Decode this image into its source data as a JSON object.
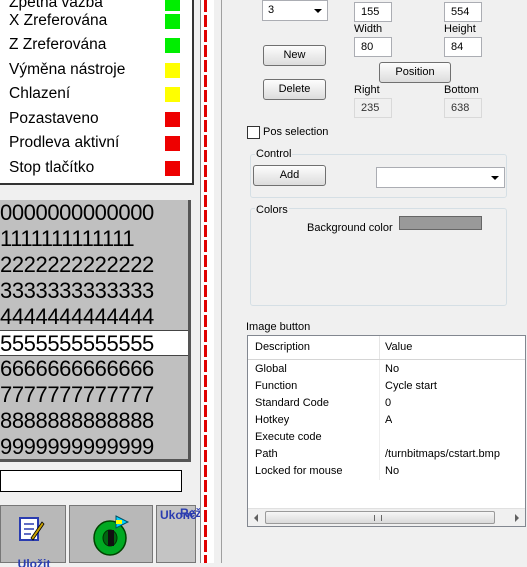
{
  "status_list": [
    {
      "label": "Zpětná vazba",
      "color": "#00ee00"
    },
    {
      "label": "X Zreferována",
      "color": "#00ee00"
    },
    {
      "label": "Z Zreferována",
      "color": "#00ee00"
    },
    {
      "label": "Výměna nástroje",
      "color": "#ffff00"
    },
    {
      "label": "Chlazení",
      "color": "#ffff00"
    },
    {
      "label": "Pozastaveno",
      "color": "#ee0000"
    },
    {
      "label": "Prodleva aktivní",
      "color": "#ee0000"
    },
    {
      "label": "Stop tlačítko",
      "color": "#ee0000"
    }
  ],
  "digit_rows": [
    "0000000000000",
    "1111111111111",
    "2222222222222",
    "3333333333333",
    "4444444444444",
    "5555555555555",
    "6666666666666",
    "7777777777777",
    "8888888888888",
    "9999999999999"
  ],
  "digit_selected_index": 5,
  "bottom_bar": {
    "left_label": "Uložit",
    "end_label": "Ukonč",
    "mode_label": "Reži"
  },
  "properties": {
    "index_value": "3",
    "left_value": "155",
    "top_value": "554",
    "width_label": "Width",
    "width_value": "80",
    "height_label": "Height",
    "height_value": "84",
    "new_button": "New",
    "delete_button": "Delete",
    "position_button": "Position",
    "right_label": "Right",
    "right_value": "235",
    "bottom_label": "Bottom",
    "bottom_value": "638",
    "pos_selection_label": "Pos selection",
    "pos_selection_checked": false
  },
  "control_group": {
    "title": "Control",
    "add_button": "Add",
    "select_value": ""
  },
  "colors_group": {
    "title": "Colors",
    "background_label": "Background color",
    "background_color": "#999999"
  },
  "image_button": {
    "title": "Image button",
    "columns": [
      "Description",
      "Value"
    ],
    "rows": [
      {
        "description": "Global",
        "value": "No"
      },
      {
        "description": "Function",
        "value": "Cycle start"
      },
      {
        "description": "Standard Code",
        "value": "0"
      },
      {
        "description": "Hotkey",
        "value": "A"
      },
      {
        "description": "Execute code",
        "value": ""
      },
      {
        "description": "Path",
        "value": "/turnbitmaps/cstart.bmp"
      },
      {
        "description": "Locked for mouse",
        "value": "No"
      }
    ]
  }
}
